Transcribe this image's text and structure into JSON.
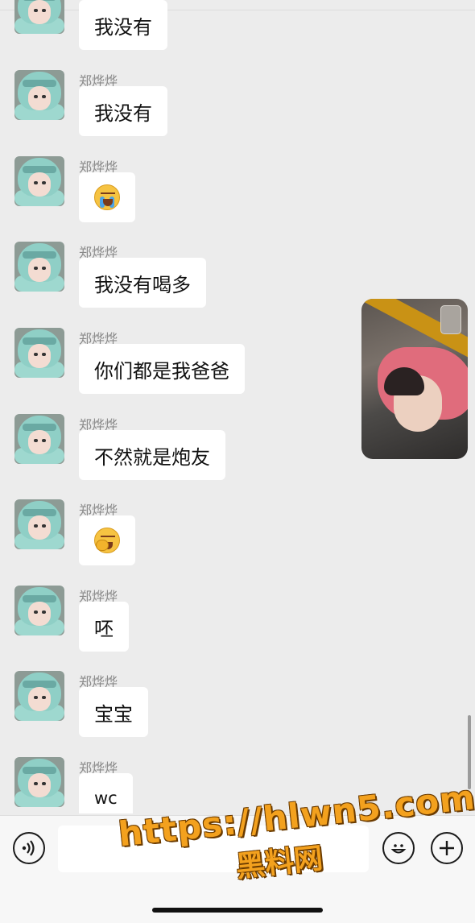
{
  "messages": [
    {
      "sender": "",
      "text": "我没有"
    },
    {
      "sender": "郑烨烨",
      "text": "我没有"
    },
    {
      "sender": "郑烨烨",
      "emoji": "crying-face-icon"
    },
    {
      "sender": "郑烨烨",
      "text": "我没有喝多"
    },
    {
      "sender": "郑烨烨",
      "text": "你们都是我爸爸"
    },
    {
      "sender": "郑烨烨",
      "text": "不然就是炮友"
    },
    {
      "sender": "郑烨烨",
      "emoji": "face-palm-icon"
    },
    {
      "sender": "郑烨烨",
      "text": "呸"
    },
    {
      "sender": "郑烨烨",
      "text": "宝宝"
    },
    {
      "sender": "郑烨烨",
      "text": "wc"
    }
  ],
  "input_bar": {
    "voice_icon": "voice-icon",
    "emoji_icon": "emoji-icon",
    "plus_icon": "plus-icon",
    "text_value": ""
  },
  "video_call": {
    "icon": "video-call-thumbnail"
  },
  "watermark": {
    "url": "https://hlwn5.com",
    "brand": "黑料网"
  },
  "colors": {
    "background": "#ececec",
    "bubble": "#ffffff",
    "watermark": "#f3a11e"
  }
}
